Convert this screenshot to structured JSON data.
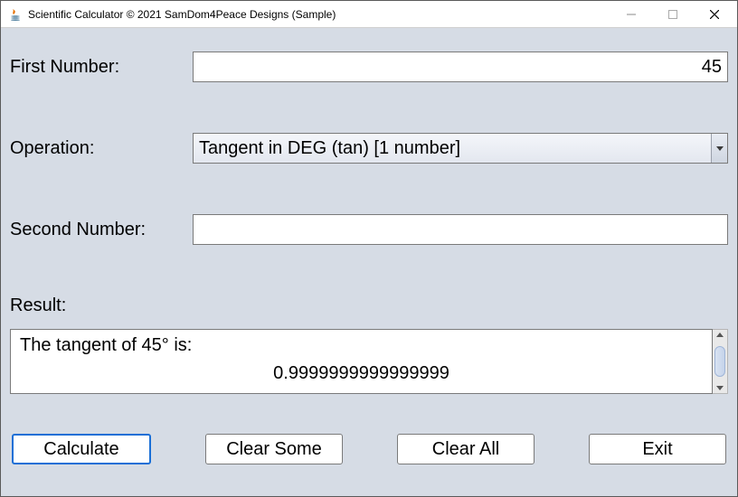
{
  "window": {
    "title": "Scientific Calculator © 2021 SamDom4Peace Designs (Sample)"
  },
  "labels": {
    "first_number": "First Number:",
    "operation": "Operation:",
    "second_number": "Second Number:",
    "result": "Result:"
  },
  "inputs": {
    "first_number_value": "45",
    "second_number_value": ""
  },
  "operation": {
    "selected": "Tangent in DEG (tan) [1 number]"
  },
  "result": {
    "line1": "The tangent of 45° is:",
    "line2": "0.9999999999999999"
  },
  "buttons": {
    "calculate": "Calculate",
    "clear_some": "Clear Some",
    "clear_all": "Clear All",
    "exit": "Exit"
  }
}
